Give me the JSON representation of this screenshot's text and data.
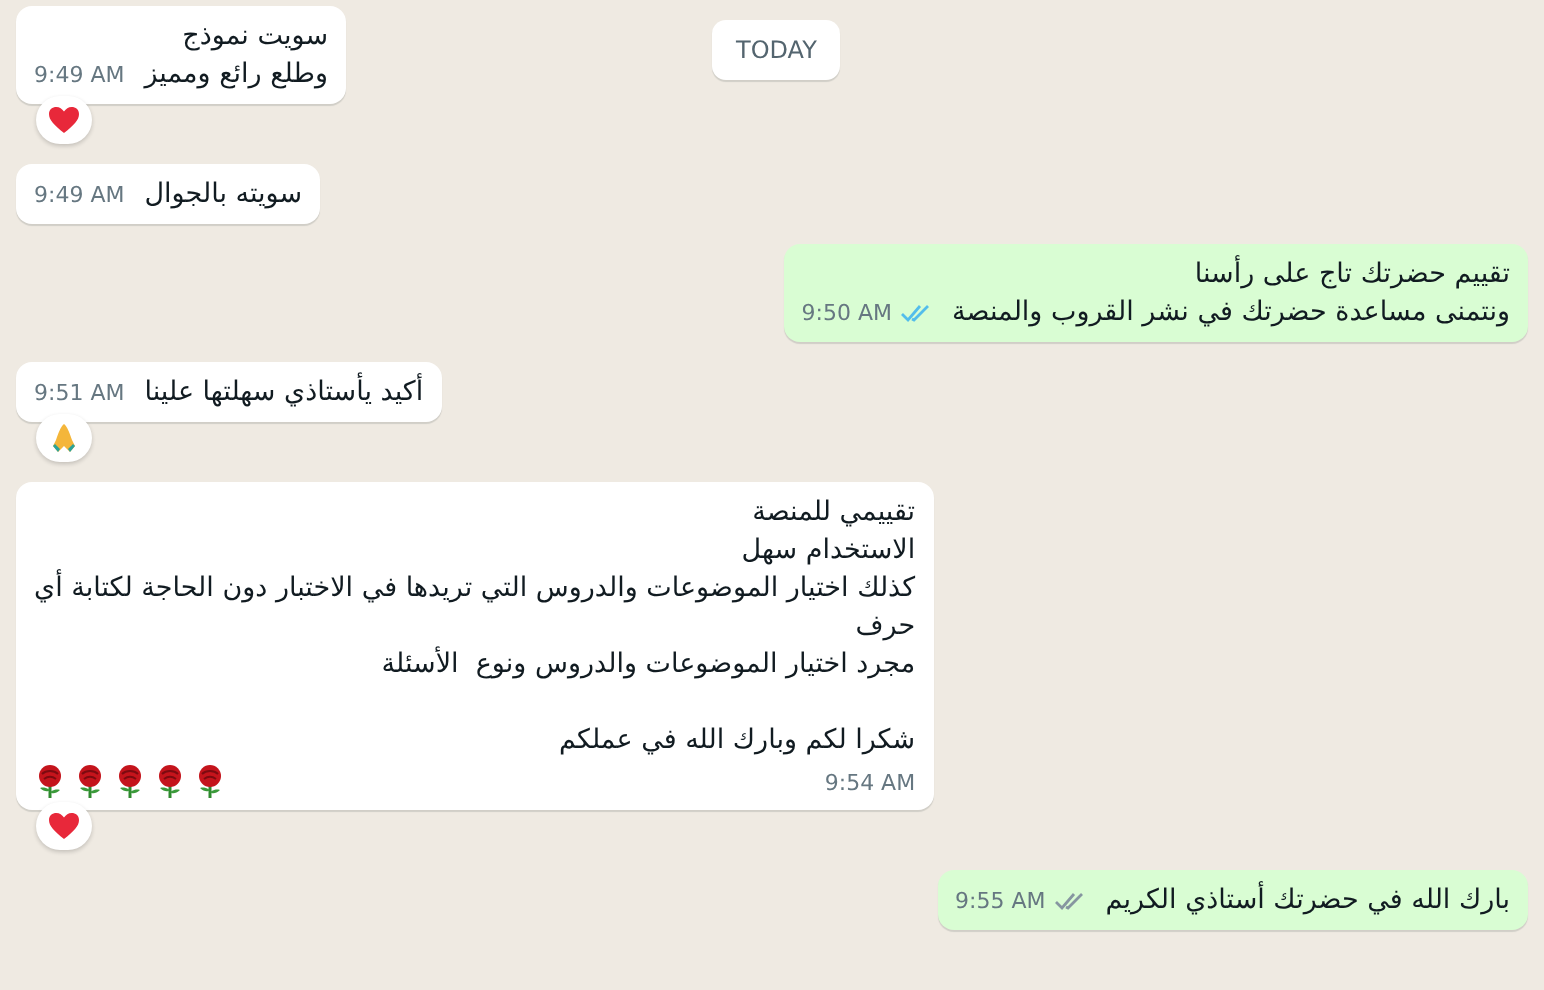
{
  "date_chip": "TODAY",
  "messages": [
    {
      "kind": "incoming",
      "paragraphs": [
        [
          "سويت نموذج",
          "وطلع رائع ومميز"
        ]
      ],
      "time": "9:49 AM",
      "reaction": {
        "kind": "heart"
      }
    },
    {
      "kind": "incoming",
      "paragraphs": [
        [
          "سويته بالجوال"
        ]
      ],
      "time": "9:49 AM"
    },
    {
      "kind": "outgoing",
      "paragraphs": [
        [
          "تقييم حضرتك تاج على رأسنا",
          "ونتمنى مساعدة حضرتك في نشر القروب والمنصة"
        ]
      ],
      "time": "9:50 AM",
      "read": true
    },
    {
      "kind": "incoming",
      "paragraphs": [
        [
          "أكيد يأستاذي سهلتها علينا"
        ]
      ],
      "time": "9:51 AM",
      "reaction": {
        "kind": "pray"
      }
    },
    {
      "kind": "incoming",
      "paragraphs": [
        [
          "تقييمي للمنصة",
          "الاستخدام سهل",
          "كذلك اختيار الموضوعات والدروس التي تريدها في الاختبار دون الحاجة لكتابة أي",
          "حرف",
          "مجرد اختيار الموضوعات والدروس ونوع  الأسئلة"
        ],
        [
          "شكرا لكم وبارك الله في عملكم"
        ]
      ],
      "trailing_icons": [
        {
          "kind": "rose"
        },
        {
          "kind": "rose"
        },
        {
          "kind": "rose"
        },
        {
          "kind": "rose"
        },
        {
          "kind": "rose"
        }
      ],
      "time": "9:54 AM",
      "reaction": {
        "kind": "heart"
      }
    },
    {
      "kind": "outgoing",
      "paragraphs": [
        [
          "بارك الله في حضرتك أستاذي الكريم"
        ]
      ],
      "time": "9:55 AM",
      "read": false
    }
  ]
}
